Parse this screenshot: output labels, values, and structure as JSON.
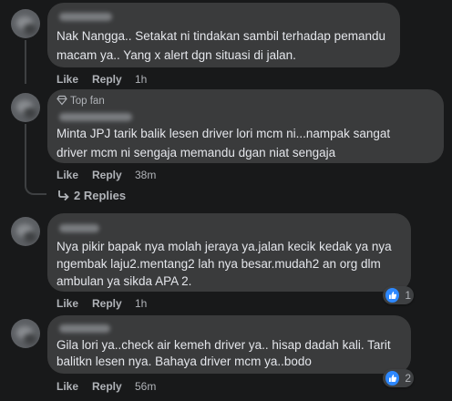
{
  "comments": [
    {
      "name": "",
      "text_lines": [
        "Nak Nangga.. Setakat ni tindakan sambil terhadap pemandu",
        "macam ya.. Yang x alert dgn situasi di jalan."
      ],
      "like": "Like",
      "reply": "Reply",
      "time": "1h"
    },
    {
      "badge": "Top fan",
      "name": "",
      "text_lines": [
        "Minta JPJ tarik balik lesen driver lori mcm ni...nampak sangat",
        "driver mcm ni sengaja memandu dgan niat sengaja"
      ],
      "like": "Like",
      "reply": "Reply",
      "time": "38m",
      "replies_label": "2 Replies"
    },
    {
      "name": "",
      "text_lines": [
        "Nya pikir bapak nya molah jeraya ya.jalan kecik kedak ya nya",
        "ngembak laju2.mentang2 lah nya besar.mudah2 an org dlm",
        "ambulan ya sikda APA 2."
      ],
      "like": "Like",
      "reply": "Reply",
      "time": "1h",
      "reaction": {
        "icon": "thumbs-up-icon",
        "count": "1"
      }
    },
    {
      "name": "",
      "text_lines": [
        "Gila lori ya..check air kemeh driver ya.. hisap dadah kali. Tarit",
        "balitkn lesen nya. Bahaya driver mcm ya..bodo"
      ],
      "like": "Like",
      "reply": "Reply",
      "time": "56m",
      "reaction": {
        "icon": "thumbs-up-icon",
        "count": "2"
      }
    }
  ],
  "colors": {
    "background": "#18191a",
    "bubble": "#3a3b3c",
    "text": "#e4e6eb",
    "muted": "#b0b3b8",
    "like_blue": "#2d88ff"
  }
}
